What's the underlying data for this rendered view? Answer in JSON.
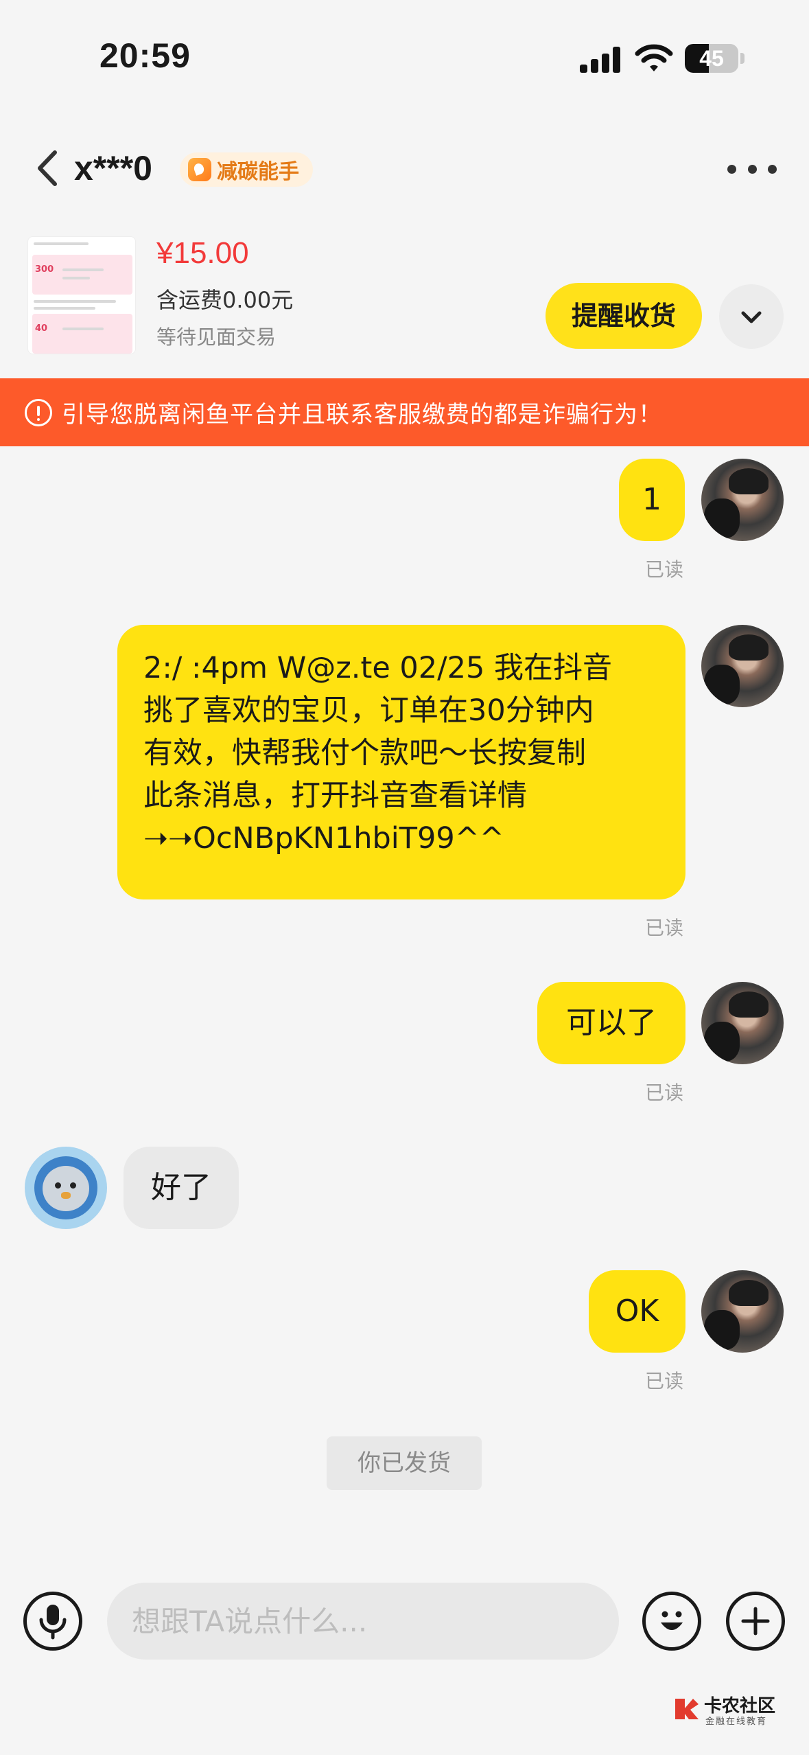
{
  "status_bar": {
    "time": "20:59",
    "battery": "45",
    "battery_level": 0.45
  },
  "header": {
    "title": "x***0",
    "badge": "减碳能手"
  },
  "product": {
    "price": "¥15.00",
    "shipping": "含运费0.00元",
    "status": "等待见面交易",
    "remind_button": "提醒收货",
    "thumb_tag_1": "300",
    "thumb_tag_2": "40"
  },
  "warning": "引导您脱离闲鱼平台并且联系客服缴费的都是诈骗行为！",
  "messages": [
    {
      "from": "me",
      "text": "1",
      "read": "已读"
    },
    {
      "from": "me",
      "lines": [
        "2:/ :4pm W@z.te 02/25 我在抖音",
        "挑了喜欢的宝贝，订单在30分钟内",
        "有效，快帮我付个款吧～长按复制",
        "此条消息，打开抖音查看详情",
        "➝➝OcNBpKN1hbiT99^^"
      ],
      "read": "已读"
    },
    {
      "from": "me",
      "text": "可以了",
      "read": "已读"
    },
    {
      "from": "other",
      "text": "好了"
    },
    {
      "from": "me",
      "text": "OK",
      "read": "已读"
    }
  ],
  "system_tag": "你已发货",
  "input": {
    "placeholder": "想跟TA说点什么..."
  },
  "watermark": {
    "title": "卡农社区",
    "subtitle": "金融在线教育"
  },
  "colors": {
    "accent_yellow": "#ffe211",
    "warning_orange": "#fd5a2a",
    "price_red": "#f23a3a",
    "badge_orange": "#e47b17"
  },
  "icons": [
    "back-icon",
    "more-icon",
    "chevron-down-icon",
    "alert-circle-icon",
    "microphone-icon",
    "emoji-icon",
    "plus-icon",
    "leaf-icon"
  ]
}
